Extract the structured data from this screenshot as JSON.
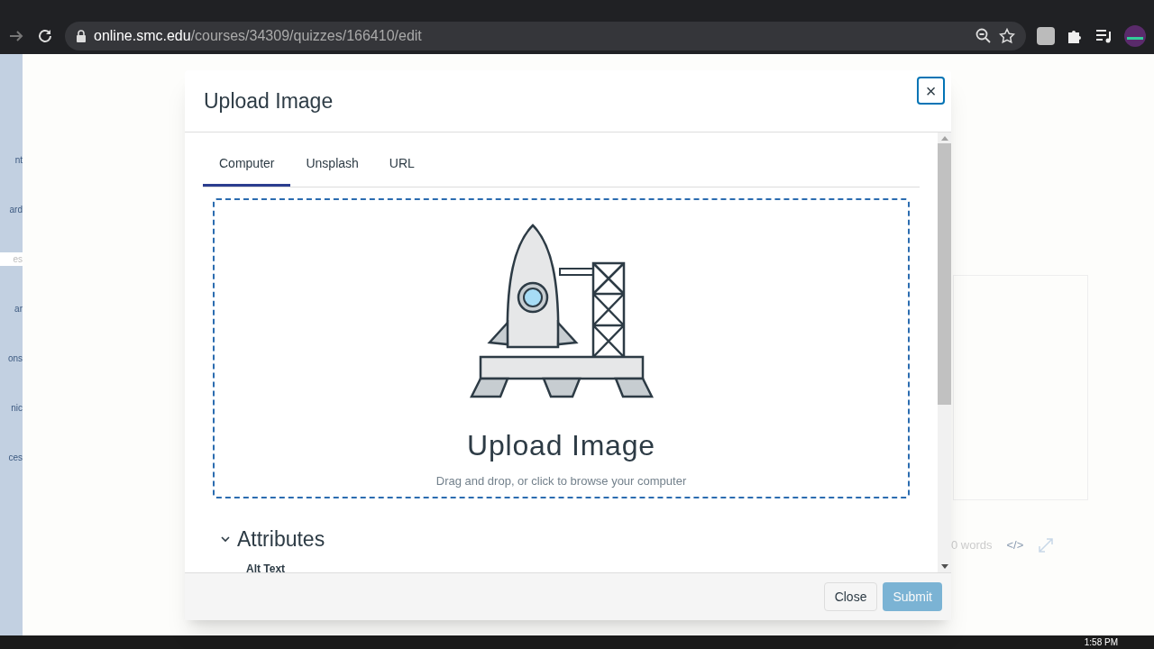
{
  "browser": {
    "url_host": "online.smc.edu",
    "url_path": "/courses/34309/quizzes/166410/edit"
  },
  "sidebar": {
    "items": [
      {
        "label": "nt",
        "selected": false
      },
      {
        "label": "ard",
        "selected": false
      },
      {
        "label": "es",
        "selected": true
      },
      {
        "label": "ar",
        "selected": false
      },
      {
        "label": "ons",
        "selected": false
      },
      {
        "label": "nic",
        "selected": false
      },
      {
        "label": "ces",
        "selected": false
      }
    ]
  },
  "editor": {
    "word_count": "0 words",
    "html_toggle": "</>"
  },
  "modal": {
    "title": "Upload Image",
    "close_icon": "×",
    "tabs": [
      {
        "label": "Computer",
        "selected": true
      },
      {
        "label": "Unsplash",
        "selected": false
      },
      {
        "label": "URL",
        "selected": false
      }
    ],
    "dropzone": {
      "heading": "Upload Image",
      "hint": "Drag and drop, or click to browse your computer"
    },
    "attributes": {
      "heading": "Attributes",
      "expanded": true,
      "alt_text_label": "Alt Text"
    },
    "buttons": [
      {
        "label": "Close",
        "kind": "secondary",
        "disabled": false
      },
      {
        "label": "Submit",
        "kind": "primary",
        "disabled": true
      }
    ]
  },
  "taskbar": {
    "time": "1:58 PM"
  }
}
